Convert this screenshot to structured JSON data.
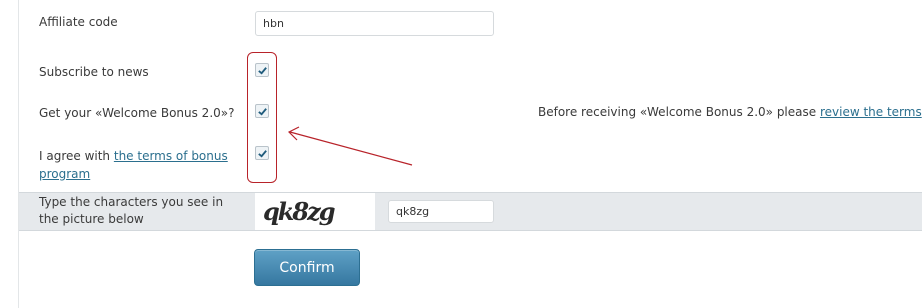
{
  "form": {
    "affiliate": {
      "label": "Affiliate code",
      "value": "hbn"
    },
    "subscribe": {
      "label": "Subscribe to news",
      "checked": true
    },
    "welcome": {
      "label": "Get your «Welcome Bonus 2.0»?",
      "checked": true,
      "note_prefix": "Before receiving «Welcome Bonus 2.0» please ",
      "note_link": "review the terms",
      "note_suffix": "."
    },
    "terms": {
      "label_prefix": "I agree with ",
      "label_link": "the terms of bonus program",
      "checked": true
    },
    "captcha": {
      "label": "Type the characters you see in the picture below",
      "image_text": "qk8zg",
      "value": "qk8zg"
    },
    "confirm_label": "Confirm"
  },
  "annotation": {
    "color": "#b8232a"
  },
  "colors": {
    "button": "#3f82ab",
    "link": "#2b6f8e",
    "band": "#e6e9ec"
  }
}
